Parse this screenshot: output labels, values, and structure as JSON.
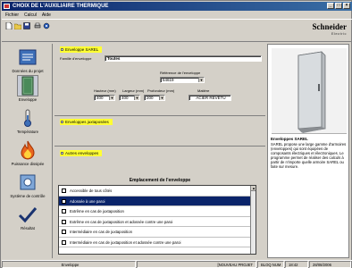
{
  "window": {
    "title": "CHOIX DE L'AUXILIAIRE THERMIQUE",
    "controls": [
      "_",
      "□",
      "×"
    ]
  },
  "menu": [
    "Fichier",
    "Calcul",
    "Aide"
  ],
  "logo": {
    "name": "Schneider",
    "sub": "Electric"
  },
  "nav": [
    {
      "label": "Données du projet",
      "icon": "project-data-icon"
    },
    {
      "label": "Enveloppe",
      "icon": "enclosure-icon"
    },
    {
      "label": "Température",
      "icon": "thermometer-icon"
    },
    {
      "label": "Puissance dissipée",
      "icon": "flame-icon"
    },
    {
      "label": "Système de contrôle",
      "icon": "control-system-icon"
    },
    {
      "label": "Résultat",
      "icon": "result-icon"
    }
  ],
  "sections": {
    "sarel": "Enveloppe SAREL",
    "juxtaposees": "Enveloppes juxtaposées",
    "autres": "Autres enveloppes"
  },
  "form": {
    "famille_label": "Famille d'enveloppe",
    "famille_value": "Toutes",
    "reference_label": "Référence de l'enveloppe",
    "reference_value": "54619",
    "hauteur_label": "Hauteur (mm)",
    "hauteur_value": "400",
    "largeur_label": "Largeur (mm)",
    "largeur_value": "400",
    "profondeur_label": "Profondeur (mm)",
    "profondeur_value": "200",
    "matiere_label": "Matière",
    "matiere_value": "ACIER REVÊTU"
  },
  "emplacement": {
    "title": "Emplacement de l'enveloppe",
    "rows": [
      "Accessible de tous côtés",
      "Adossée à une paroi",
      "Extrême en cas de juxtaposition",
      "Extrême en cas de juxtaposition et adossée contre une paroi",
      "Intermédiaire en cas de juxtaposition",
      "Intermédiaire en cas de juxtaposition et adossée contre une paroi"
    ],
    "selected_index": 1
  },
  "description": {
    "title": "Enveloppes SAREL",
    "text": "SAREL propose une large gamme d'armoires (enveloppes) qui sont équipées de composants électriques et électroniques. Le programme permet de réaliser des calculs à partir de n'importe quelle armoire SAREL ou faite sur mesure."
  },
  "status": {
    "section": "Enveloppe",
    "project": "[NOUVEAU PROJET",
    "state": "BLOQ NUM",
    "time": "18:42",
    "date": "28/08/2006"
  },
  "colors": {
    "titlebar": "#0a246a",
    "section_highlight": "#ffff33",
    "selection": "#0a246a"
  }
}
